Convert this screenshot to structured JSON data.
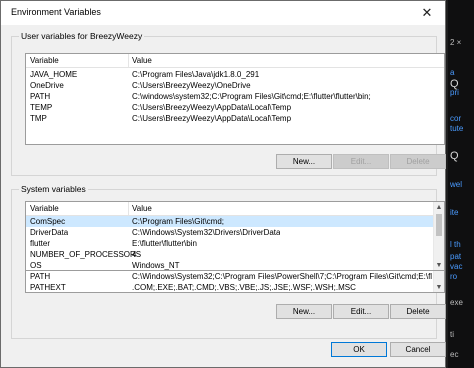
{
  "dialog": {
    "title": "Environment Variables",
    "close_glyph": "✕"
  },
  "user_section": {
    "label": "User variables for BreezyWeezy",
    "columns": [
      "Variable",
      "Value"
    ],
    "rows": [
      {
        "variable": "JAVA_HOME",
        "value": "C:\\Program Files\\Java\\jdk1.8.0_291"
      },
      {
        "variable": "OneDrive",
        "value": "C:\\Users\\BreezyWeezy\\OneDrive"
      },
      {
        "variable": "PATH",
        "value": "C:\\windows\\system32;C:\\Program Files\\Git\\cmd;E:\\flutter\\flutter\\bin;"
      },
      {
        "variable": "TEMP",
        "value": "C:\\Users\\BreezyWeezy\\AppData\\Local\\Temp"
      },
      {
        "variable": "TMP",
        "value": "C:\\Users\\BreezyWeezy\\AppData\\Local\\Temp"
      }
    ],
    "buttons": {
      "new": "New...",
      "edit": "Edit...",
      "delete": "Delete"
    }
  },
  "system_section": {
    "label": "System variables",
    "columns": [
      "Variable",
      "Value"
    ],
    "rows": [
      {
        "variable": "ComSpec",
        "value": "C:\\Program Files\\Git\\cmd;"
      },
      {
        "variable": "DriverData",
        "value": "C:\\Windows\\System32\\Drivers\\DriverData"
      },
      {
        "variable": "flutter",
        "value": "E:\\flutter\\flutter\\bin"
      },
      {
        "variable": "NUMBER_OF_PROCESSORS",
        "value": "4"
      },
      {
        "variable": "OS",
        "value": "Windows_NT"
      },
      {
        "variable": "PATH",
        "value": "C:\\Windows\\System32;C:\\Program Files\\PowerShell\\7;C:\\Program Files\\Git\\cmd;E:\\flutte..."
      },
      {
        "variable": "PATHEXT",
        "value": ".COM;.EXE;.BAT;.CMD;.VBS;.VBE;.JS;.JSE;.WSF;.WSH;.MSC"
      }
    ],
    "buttons": {
      "new": "New...",
      "edit": "Edit...",
      "delete": "Delete"
    }
  },
  "footer": {
    "ok": "OK",
    "cancel": "Cancel"
  },
  "colors": {
    "selected_row": "#cde8ff",
    "focus_border": "#0078d7"
  },
  "background_fragments": {
    "right": [
      "2 ×",
      "a",
      "Q",
      "pri",
      "cor",
      "tute",
      "Q",
      "wel",
      "ite",
      "l th",
      "pat",
      "vac",
      "ro",
      "exe",
      "ti",
      "ec"
    ],
    "left": [
      "e",
      "A",
      "A"
    ]
  }
}
